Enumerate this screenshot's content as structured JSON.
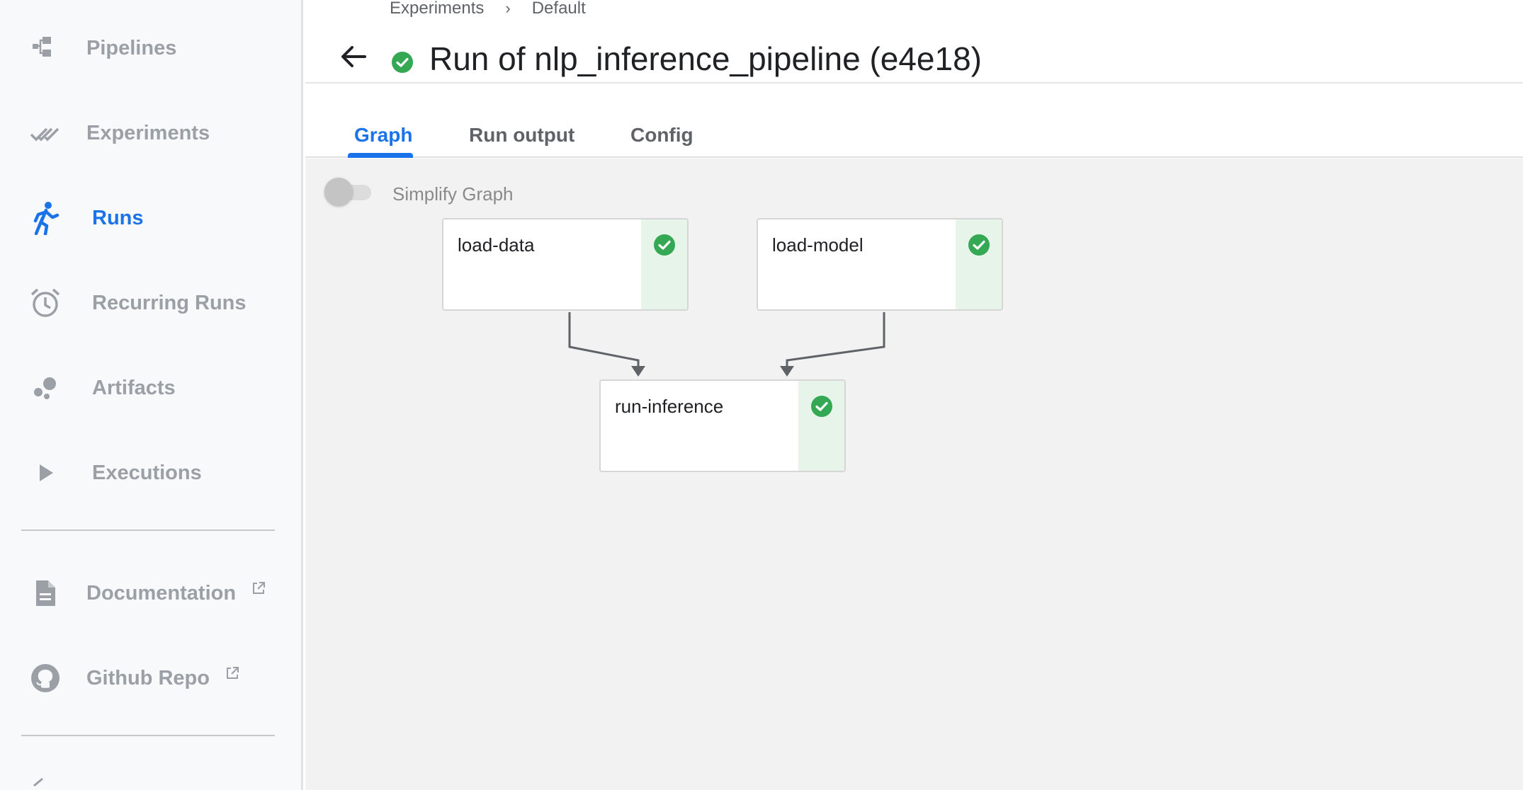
{
  "sidebar": {
    "items": [
      {
        "label": "Pipelines",
        "icon": "pipelines-icon",
        "active": false
      },
      {
        "label": "Experiments",
        "icon": "experiments-icon",
        "active": false
      },
      {
        "label": "Runs",
        "icon": "runs-icon",
        "active": true
      },
      {
        "label": "Recurring Runs",
        "icon": "alarm-clock-icon",
        "active": false
      },
      {
        "label": "Artifacts",
        "icon": "artifacts-icon",
        "active": false
      },
      {
        "label": "Executions",
        "icon": "play-icon",
        "active": false
      }
    ],
    "links": [
      {
        "label": "Documentation",
        "icon": "document-icon",
        "external_icon": "open-in-new-icon"
      },
      {
        "label": "Github Repo",
        "icon": "github-icon",
        "external_icon": "open-in-new-icon"
      }
    ]
  },
  "header": {
    "breadcrumb": [
      {
        "label": "Experiments"
      },
      {
        "label": "Default"
      }
    ],
    "breadcrumb_separator": "›",
    "title": "Run of nlp_inference_pipeline (e4e18)",
    "status": "success"
  },
  "tabs": [
    {
      "label": "Graph",
      "active": true
    },
    {
      "label": "Run output",
      "active": false
    },
    {
      "label": "Config",
      "active": false
    }
  ],
  "graph": {
    "simplify_toggle_label": "Simplify Graph",
    "simplify_enabled": false,
    "nodes": [
      {
        "id": "load-data",
        "label": "load-data",
        "status": "success"
      },
      {
        "id": "load-model",
        "label": "load-model",
        "status": "success"
      },
      {
        "id": "run-inference",
        "label": "run-inference",
        "status": "success"
      }
    ],
    "edges": [
      {
        "from": "load-data",
        "to": "run-inference"
      },
      {
        "from": "load-model",
        "to": "run-inference"
      }
    ]
  },
  "colors": {
    "accent": "#1a73e8",
    "success": "#34a853",
    "success_bg": "#e6f4ea",
    "nav_inactive": "#9aa0a6"
  }
}
